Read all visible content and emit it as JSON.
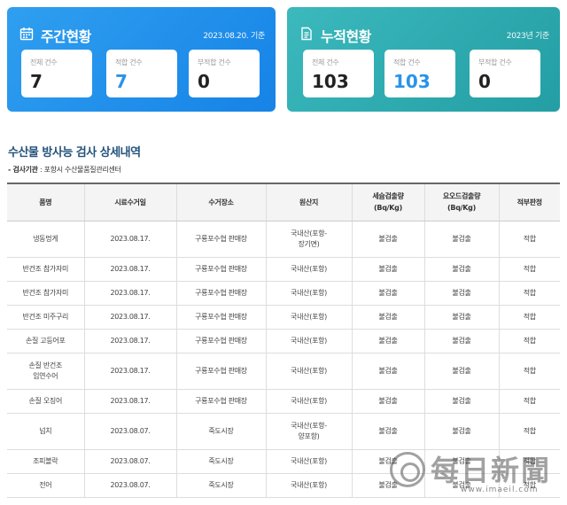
{
  "weekly": {
    "title": "주간현황",
    "date": "2023.08.20. 기준",
    "stats": [
      {
        "label": "전체 건수",
        "value": "7"
      },
      {
        "label": "적합 건수",
        "value": "7"
      },
      {
        "label": "부적합 건수",
        "value": "0"
      }
    ],
    "color": "#1a8aea",
    "icon": "calendar-icon"
  },
  "cumulative": {
    "title": "누적현황",
    "date": "2023년 기준",
    "stats": [
      {
        "label": "전체 건수",
        "value": "103"
      },
      {
        "label": "적합 건수",
        "value": "103"
      },
      {
        "label": "부적합 건수",
        "value": "0"
      }
    ],
    "color": "#2ba9ae",
    "icon": "document-icon"
  },
  "detail": {
    "title": "수산물 방사능 검사 상세내역",
    "agency_label": "- 검사기관",
    "agency_value": " : 포항시 수산물품질관리센터"
  },
  "table": {
    "headers": [
      "품명",
      "시료수거일",
      "수거장소",
      "원산지",
      "세슘검출량\n(Bq/Kg)",
      "요오드검출량\n(Bq/Kg)",
      "적부판정"
    ],
    "rows": [
      [
        "냉동멍게",
        "2023.08.17.",
        "구룡포수협 판매장",
        "국내산(포항-\n장기면)",
        "불검출",
        "불검출",
        "적합"
      ],
      [
        "반건조 참가자미",
        "2023.08.17.",
        "구룡포수협 판매장",
        "국내산(포항)",
        "불검출",
        "불검출",
        "적합"
      ],
      [
        "반건조 참가자미",
        "2023.08.17.",
        "구룡포수협 판매장",
        "국내산(포항)",
        "불검출",
        "불검출",
        "적합"
      ],
      [
        "반건조 미주구리",
        "2023.08.17.",
        "구룡포수협 판매장",
        "국내산(포항)",
        "불검출",
        "불검출",
        "적합"
      ],
      [
        "손질 고등어포",
        "2023.08.17.",
        "구룡포수협 판매장",
        "국내산(포항)",
        "불검출",
        "불검출",
        "적합"
      ],
      [
        "손질 반건조\n임연수어",
        "2023.08.17.",
        "구룡포수협 판매장",
        "국내산(포항)",
        "불검출",
        "불검출",
        "적합"
      ],
      [
        "손질 오징어",
        "2023.08.17.",
        "구룡포수협 판매장",
        "국내산(포항)",
        "불검출",
        "불검출",
        "적합"
      ],
      [
        "넙치",
        "2023.08.07.",
        "죽도시장",
        "국내산(포항-\n양포항)",
        "불검출",
        "불검출",
        "적합"
      ],
      [
        "조피볼락",
        "2023.08.07.",
        "죽도시장",
        "국내산(포항)",
        "불검출",
        "불검출",
        "적합"
      ],
      [
        "전어",
        "2023.08.07.",
        "죽도시장",
        "국내산(포항)",
        "불검출",
        "불검출",
        "적합"
      ]
    ]
  },
  "watermark": {
    "name": "每日新聞",
    "url": "www.imaeil.com"
  }
}
